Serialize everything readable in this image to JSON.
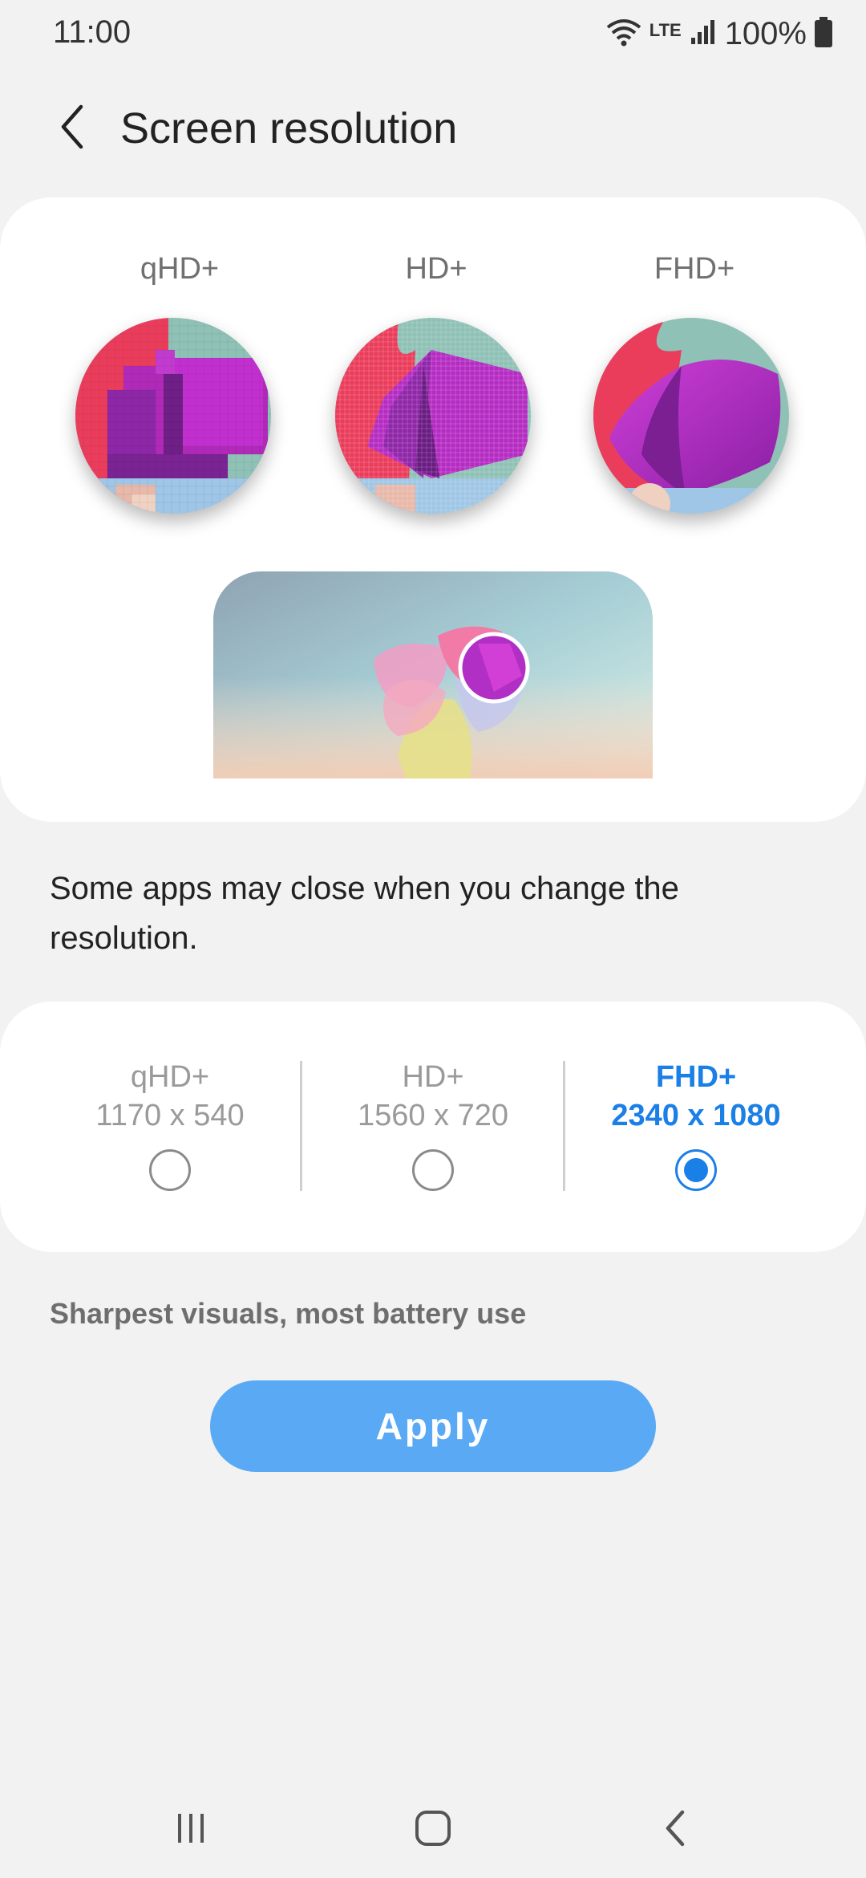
{
  "status_bar": {
    "time": "11:00",
    "network_label": "LTE",
    "battery": "100%"
  },
  "header": {
    "title": "Screen resolution",
    "back_icon": "chevron-left-icon"
  },
  "preview": {
    "columns": [
      {
        "label": "qHD+"
      },
      {
        "label": "HD+"
      },
      {
        "label": "FHD+"
      }
    ]
  },
  "notice": "Some apps may close when you change the resolution.",
  "options": [
    {
      "name": "qHD+",
      "resolution": "1170 x 540",
      "selected": false
    },
    {
      "name": "HD+",
      "resolution": "1560 x 720",
      "selected": false
    },
    {
      "name": "FHD+",
      "resolution": "2340 x 1080",
      "selected": true
    }
  ],
  "description": "Sharpest visuals, most battery use",
  "apply_label": "Apply",
  "colors": {
    "accent": "#1a7fe6",
    "apply_button": "#5aa9f5",
    "background": "#f2f2f2",
    "card": "#ffffff"
  },
  "nav_bar": {
    "recents_icon": "recents-icon",
    "home_icon": "home-icon",
    "back_icon": "back-icon"
  }
}
